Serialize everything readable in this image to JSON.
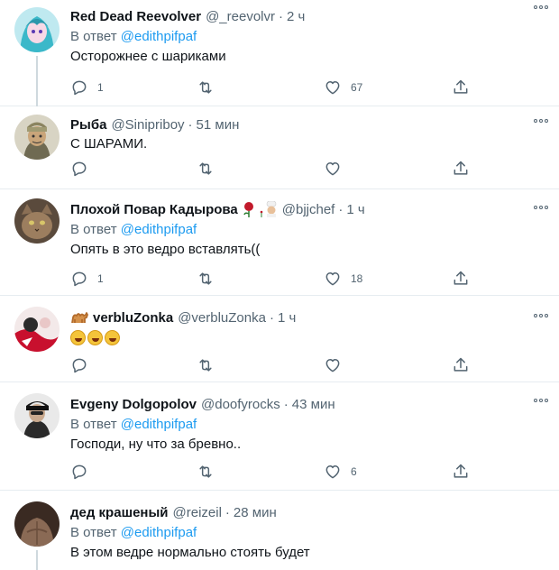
{
  "colors": {
    "accent": "#1d9bf0",
    "secondary_text": "#536471",
    "divider": "#e6ecf0"
  },
  "icons": {
    "reply": "reply-icon",
    "retweet": "retweet-icon",
    "like": "heart-icon",
    "share": "share-icon",
    "more": "more-icon"
  },
  "tweets": [
    {
      "name": "Red Dead Reevolver",
      "handle": "@_reevolvr",
      "sep": "·",
      "time": "2 ч",
      "reply_prefix": "В ответ",
      "reply_mention": "@edithpifpaf",
      "text": "Осторожнее с шариками",
      "replies": "1",
      "likes": "67"
    },
    {
      "name": "Рыба",
      "handle": "@Sinipriboy",
      "sep": "·",
      "time": "51 мин",
      "text": "С ШАРАМИ.",
      "replies": "",
      "likes": ""
    },
    {
      "name": "Плохой Повар Кадырова",
      "handle": "@bjjchef",
      "sep": "·",
      "time": "1 ч",
      "reply_prefix": "В ответ",
      "reply_mention": "@edithpifpaf",
      "text": "Опять в это ведро вставлять((",
      "replies": "1",
      "likes": "18"
    },
    {
      "name": "verbluZonka",
      "handle": "@verbluZonka",
      "sep": "·",
      "time": "1 ч",
      "replies": "",
      "likes": ""
    },
    {
      "name": "Evgeny Dolgopolov",
      "handle": "@doofyrocks",
      "sep": "·",
      "time": "43 мин",
      "reply_prefix": "В ответ",
      "reply_mention": "@edithpifpaf",
      "text": "Господи, ну что за бревно..",
      "replies": "",
      "likes": "6"
    },
    {
      "name": "дед крашеный",
      "handle": "@reizeil",
      "sep": "·",
      "time": "28 мин",
      "reply_prefix": "В ответ",
      "reply_mention": "@edithpifpaf",
      "text": "В этом ведре нормально стоять будет"
    }
  ]
}
